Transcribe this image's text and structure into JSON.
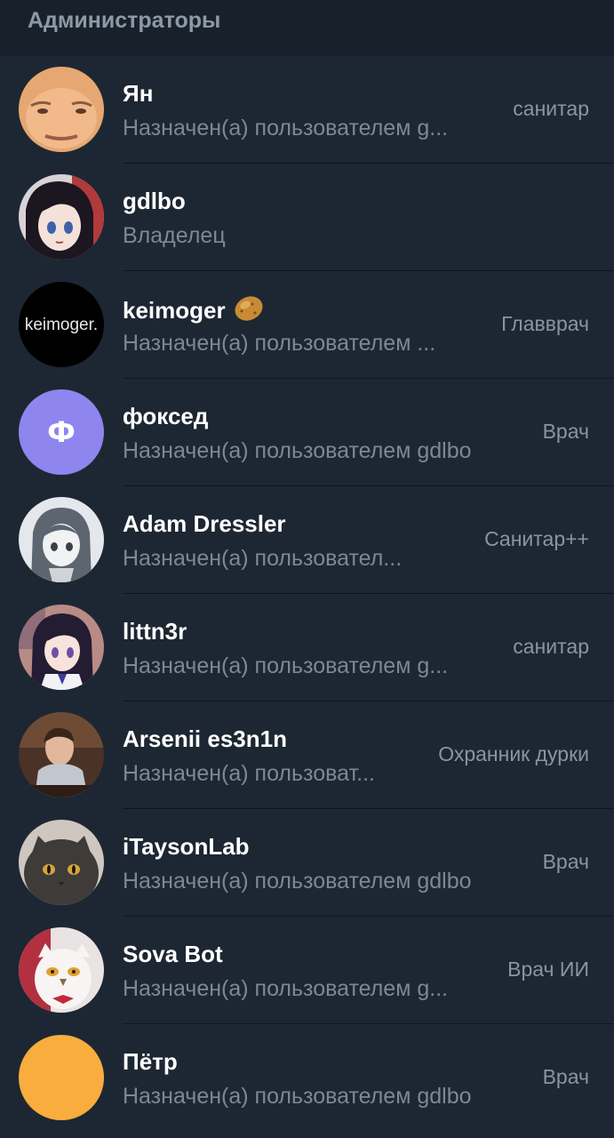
{
  "section": {
    "title": "Администраторы"
  },
  "admins": [
    {
      "name": "Ян",
      "subtitle": "Назначен(а) пользователем g...",
      "role": "санитар",
      "avatar": "photo-face"
    },
    {
      "name": "gdlbo",
      "subtitle": "Владелец",
      "role": "",
      "avatar": "anime-girl-red"
    },
    {
      "name": "keimoger",
      "subtitle": "Назначен(а) пользователем ...",
      "role": "Главврач",
      "avatar": "keimoger-logo",
      "avatar_text": "keimoger.",
      "emoji": "potato-emoji"
    },
    {
      "name": "фоксед",
      "subtitle": "Назначен(а) пользователем gdlbo",
      "role": "Врач",
      "avatar": "letter",
      "avatar_letter": "Ф",
      "avatar_color": "#8e85ee"
    },
    {
      "name": "Adam Dressler",
      "subtitle": "Назначен(а) пользовател...",
      "role": "Санитар++",
      "avatar": "anime-sketch"
    },
    {
      "name": "littn3r",
      "subtitle": "Назначен(а) пользователем g...",
      "role": "санитар",
      "avatar": "anime-girl-purple"
    },
    {
      "name": "Arsenii es3n1n",
      "subtitle": "Назначен(а) пользоват...",
      "role": "Охранник дурки",
      "avatar": "photo-man"
    },
    {
      "name": "iTaysonLab",
      "subtitle": "Назначен(а) пользователем gdlbo",
      "role": "Врач",
      "avatar": "photo-cat"
    },
    {
      "name": "Sova Bot",
      "subtitle": "Назначен(а) пользователем g...",
      "role": "Врач ИИ",
      "avatar": "owl-mascot"
    },
    {
      "name": "Пётр",
      "subtitle": "Назначен(а) пользователем gdlbo",
      "role": "Врач",
      "avatar": "plain-color",
      "avatar_color": "#f8ad3e"
    }
  ],
  "colors": {
    "background": "#1d2733",
    "header_background": "#18212b",
    "name": "#ffffff",
    "subtitle": "#7d8894",
    "role": "#8a959f"
  }
}
